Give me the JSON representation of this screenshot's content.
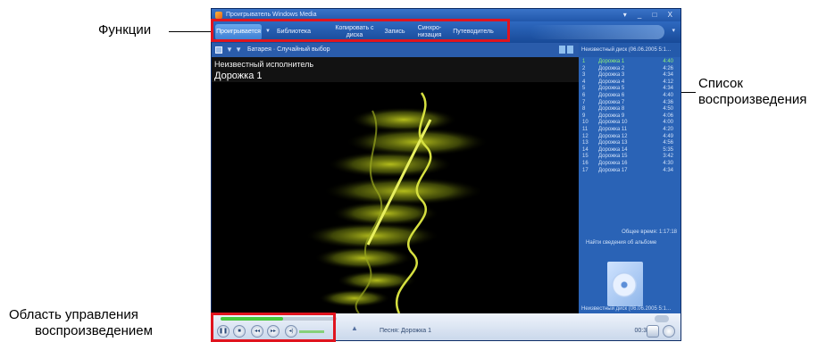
{
  "annotations": {
    "functions": "Функции",
    "playlist_line1": "Список",
    "playlist_line2": "воспроизведения",
    "controls_line1": "Область управления",
    "controls_line2": "воспроизведением"
  },
  "window": {
    "title": "Проигрыватель Windows Media",
    "controls": "▾ _ □ X"
  },
  "taskbar": {
    "items": [
      {
        "label": "Проигрывается",
        "active": true
      },
      {
        "label": "Библиотека"
      },
      {
        "label": "Копировать с диска"
      },
      {
        "label": "Запись"
      },
      {
        "label": "Синхро-низация"
      },
      {
        "label": "Путеводитель"
      }
    ]
  },
  "subbar": {
    "text": "Батарея · Случайный выбор"
  },
  "visualization": {
    "artist": "Неизвестный исполнитель",
    "track": "Дорожка 1"
  },
  "playlist": {
    "header": "Неизвестный диск (06.06.2005 5:1…",
    "items": [
      {
        "n": "1",
        "title": "Дорожка 1",
        "duration": "4:40",
        "current": true
      },
      {
        "n": "2",
        "title": "Дорожка 2",
        "duration": "4:26"
      },
      {
        "n": "3",
        "title": "Дорожка 3",
        "duration": "4:34"
      },
      {
        "n": "4",
        "title": "Дорожка 4",
        "duration": "4:12"
      },
      {
        "n": "5",
        "title": "Дорожка 5",
        "duration": "4:34"
      },
      {
        "n": "6",
        "title": "Дорожка 6",
        "duration": "4:40"
      },
      {
        "n": "7",
        "title": "Дорожка 7",
        "duration": "4:36"
      },
      {
        "n": "8",
        "title": "Дорожка 8",
        "duration": "4:50"
      },
      {
        "n": "9",
        "title": "Дорожка 9",
        "duration": "4:06"
      },
      {
        "n": "10",
        "title": "Дорожка 10",
        "duration": "4:00"
      },
      {
        "n": "11",
        "title": "Дорожка 11",
        "duration": "4:20"
      },
      {
        "n": "12",
        "title": "Дорожка 12",
        "duration": "4:49"
      },
      {
        "n": "13",
        "title": "Дорожка 13",
        "duration": "4:56"
      },
      {
        "n": "14",
        "title": "Дорожка 14",
        "duration": "5:35"
      },
      {
        "n": "15",
        "title": "Дорожка 15",
        "duration": "3:42"
      },
      {
        "n": "16",
        "title": "Дорожка 16",
        "duration": "4:30"
      },
      {
        "n": "17",
        "title": "Дорожка 17",
        "duration": "4:34"
      }
    ],
    "total_time": "Общее время: 1:17:18",
    "find_album_info": "Найти сведения об альбоме",
    "footer": "Неизвестный диск (06.06.2005 5:1…"
  },
  "controls": {
    "now_playing": "Песня: Дорожка 1",
    "time": "00:30",
    "seek_progress": 0.54,
    "volume_level": 0.7
  }
}
